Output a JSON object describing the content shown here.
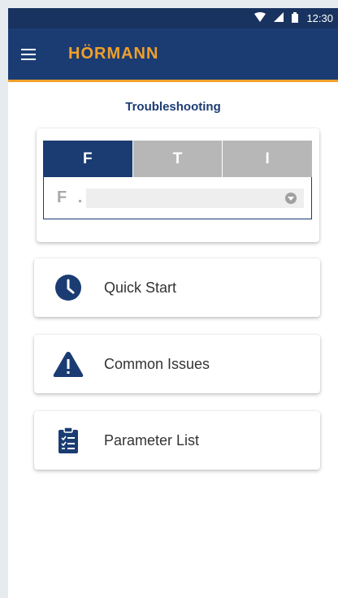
{
  "status_bar": {
    "time": "12:30"
  },
  "app_bar": {
    "brand": "HÖRMANN"
  },
  "page": {
    "title": "Troubleshooting"
  },
  "code_selector": {
    "tabs": [
      {
        "label": "F",
        "active": true
      },
      {
        "label": "T",
        "active": false
      },
      {
        "label": "I",
        "active": false
      }
    ],
    "prefix": "F .",
    "value": ""
  },
  "menu": {
    "quick_start": "Quick Start",
    "common_issues": "Common Issues",
    "parameter_list": "Parameter List"
  },
  "colors": {
    "primary": "#1b3c73",
    "accent": "#f0a02a",
    "inactive": "#b7b7b7"
  }
}
